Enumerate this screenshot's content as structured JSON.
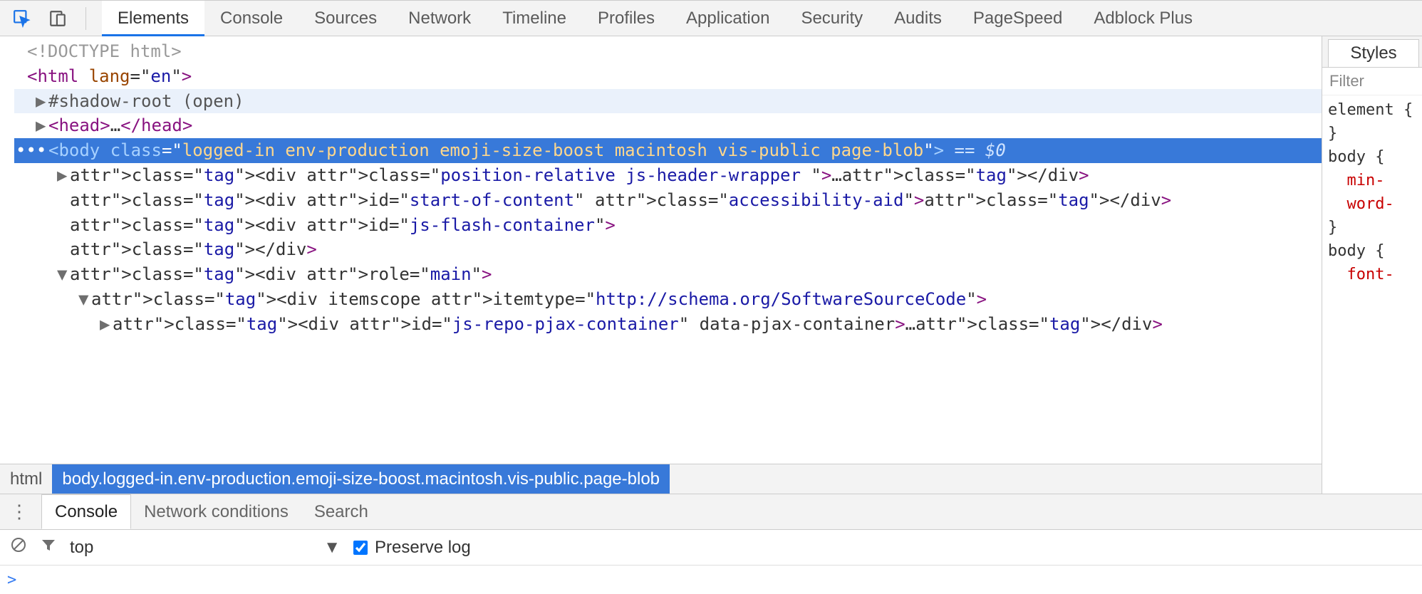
{
  "tabs": [
    "Elements",
    "Console",
    "Sources",
    "Network",
    "Timeline",
    "Profiles",
    "Application",
    "Security",
    "Audits",
    "PageSpeed",
    "Adblock Plus"
  ],
  "activeTab": "Elements",
  "dom": {
    "doctype": "<!DOCTYPE html>",
    "htmlOpen": {
      "tag": "html",
      "attrs": [
        [
          "lang",
          "en"
        ]
      ]
    },
    "shadowRoot": "#shadow-root (open)",
    "headCollapsed": "…",
    "body": {
      "tag": "body",
      "classVal": "logged-in env-production emoji-size-boost macintosh vis-public page-blob",
      "selMark": " == $0"
    },
    "children": [
      {
        "raw": "<div class=\"position-relative js-header-wrapper \">…</div>",
        "expandable": true
      },
      {
        "raw": "<div id=\"start-of-content\" class=\"accessibility-aid\"></div>"
      },
      {
        "raw": "<div id=\"js-flash-container\">"
      },
      {
        "raw": "</div>"
      },
      {
        "raw": "<div role=\"main\">",
        "open": true
      },
      {
        "raw": "<div itemscope itemtype=\"http://schema.org/SoftwareSourceCode\">",
        "open": true,
        "indent": 1
      },
      {
        "raw": "<div id=\"js-repo-pjax-container\" data-pjax-container>…</div>",
        "expandable": true,
        "indent": 2
      }
    ]
  },
  "breadcrumb": {
    "items": [
      "html",
      "body.logged-in.env-production.emoji-size-boost.macintosh.vis-public.page-blob"
    ],
    "activeIndex": 1
  },
  "styles": {
    "tab": "Styles",
    "filterPlaceholder": "Filter",
    "rules": [
      {
        "sel": "element",
        "open": true,
        "props": []
      },
      {
        "sel": "body {",
        "props": [
          "min-",
          "word-"
        ],
        "close": "}"
      },
      {
        "sel": "body {",
        "props": [
          "font-"
        ]
      }
    ]
  },
  "drawer": {
    "tabs": [
      "Console",
      "Network conditions",
      "Search"
    ],
    "active": "Console",
    "context": "top",
    "preserveLabel": "Preserve log",
    "preserveChecked": true,
    "prompt": ">"
  }
}
